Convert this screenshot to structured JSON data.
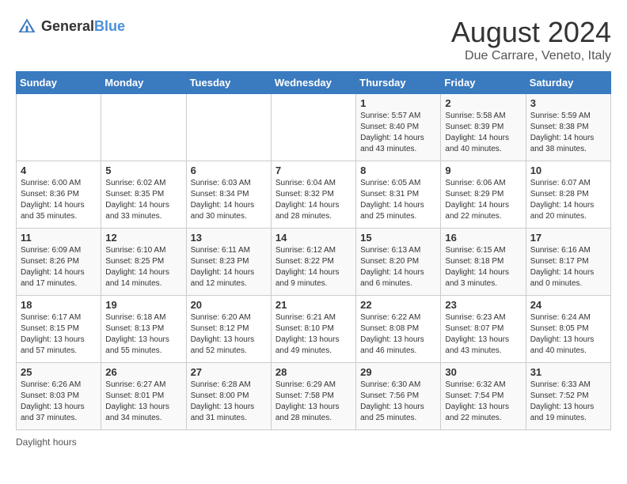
{
  "header": {
    "logo_line1": "General",
    "logo_line2": "Blue",
    "title": "August 2024",
    "subtitle": "Due Carrare, Veneto, Italy"
  },
  "calendar": {
    "days_of_week": [
      "Sunday",
      "Monday",
      "Tuesday",
      "Wednesday",
      "Thursday",
      "Friday",
      "Saturday"
    ],
    "weeks": [
      [
        {
          "day": "",
          "info": ""
        },
        {
          "day": "",
          "info": ""
        },
        {
          "day": "",
          "info": ""
        },
        {
          "day": "",
          "info": ""
        },
        {
          "day": "1",
          "info": "Sunrise: 5:57 AM\nSunset: 8:40 PM\nDaylight: 14 hours and 43 minutes."
        },
        {
          "day": "2",
          "info": "Sunrise: 5:58 AM\nSunset: 8:39 PM\nDaylight: 14 hours and 40 minutes."
        },
        {
          "day": "3",
          "info": "Sunrise: 5:59 AM\nSunset: 8:38 PM\nDaylight: 14 hours and 38 minutes."
        }
      ],
      [
        {
          "day": "4",
          "info": "Sunrise: 6:00 AM\nSunset: 8:36 PM\nDaylight: 14 hours and 35 minutes."
        },
        {
          "day": "5",
          "info": "Sunrise: 6:02 AM\nSunset: 8:35 PM\nDaylight: 14 hours and 33 minutes."
        },
        {
          "day": "6",
          "info": "Sunrise: 6:03 AM\nSunset: 8:34 PM\nDaylight: 14 hours and 30 minutes."
        },
        {
          "day": "7",
          "info": "Sunrise: 6:04 AM\nSunset: 8:32 PM\nDaylight: 14 hours and 28 minutes."
        },
        {
          "day": "8",
          "info": "Sunrise: 6:05 AM\nSunset: 8:31 PM\nDaylight: 14 hours and 25 minutes."
        },
        {
          "day": "9",
          "info": "Sunrise: 6:06 AM\nSunset: 8:29 PM\nDaylight: 14 hours and 22 minutes."
        },
        {
          "day": "10",
          "info": "Sunrise: 6:07 AM\nSunset: 8:28 PM\nDaylight: 14 hours and 20 minutes."
        }
      ],
      [
        {
          "day": "11",
          "info": "Sunrise: 6:09 AM\nSunset: 8:26 PM\nDaylight: 14 hours and 17 minutes."
        },
        {
          "day": "12",
          "info": "Sunrise: 6:10 AM\nSunset: 8:25 PM\nDaylight: 14 hours and 14 minutes."
        },
        {
          "day": "13",
          "info": "Sunrise: 6:11 AM\nSunset: 8:23 PM\nDaylight: 14 hours and 12 minutes."
        },
        {
          "day": "14",
          "info": "Sunrise: 6:12 AM\nSunset: 8:22 PM\nDaylight: 14 hours and 9 minutes."
        },
        {
          "day": "15",
          "info": "Sunrise: 6:13 AM\nSunset: 8:20 PM\nDaylight: 14 hours and 6 minutes."
        },
        {
          "day": "16",
          "info": "Sunrise: 6:15 AM\nSunset: 8:18 PM\nDaylight: 14 hours and 3 minutes."
        },
        {
          "day": "17",
          "info": "Sunrise: 6:16 AM\nSunset: 8:17 PM\nDaylight: 14 hours and 0 minutes."
        }
      ],
      [
        {
          "day": "18",
          "info": "Sunrise: 6:17 AM\nSunset: 8:15 PM\nDaylight: 13 hours and 57 minutes."
        },
        {
          "day": "19",
          "info": "Sunrise: 6:18 AM\nSunset: 8:13 PM\nDaylight: 13 hours and 55 minutes."
        },
        {
          "day": "20",
          "info": "Sunrise: 6:20 AM\nSunset: 8:12 PM\nDaylight: 13 hours and 52 minutes."
        },
        {
          "day": "21",
          "info": "Sunrise: 6:21 AM\nSunset: 8:10 PM\nDaylight: 13 hours and 49 minutes."
        },
        {
          "day": "22",
          "info": "Sunrise: 6:22 AM\nSunset: 8:08 PM\nDaylight: 13 hours and 46 minutes."
        },
        {
          "day": "23",
          "info": "Sunrise: 6:23 AM\nSunset: 8:07 PM\nDaylight: 13 hours and 43 minutes."
        },
        {
          "day": "24",
          "info": "Sunrise: 6:24 AM\nSunset: 8:05 PM\nDaylight: 13 hours and 40 minutes."
        }
      ],
      [
        {
          "day": "25",
          "info": "Sunrise: 6:26 AM\nSunset: 8:03 PM\nDaylight: 13 hours and 37 minutes."
        },
        {
          "day": "26",
          "info": "Sunrise: 6:27 AM\nSunset: 8:01 PM\nDaylight: 13 hours and 34 minutes."
        },
        {
          "day": "27",
          "info": "Sunrise: 6:28 AM\nSunset: 8:00 PM\nDaylight: 13 hours and 31 minutes."
        },
        {
          "day": "28",
          "info": "Sunrise: 6:29 AM\nSunset: 7:58 PM\nDaylight: 13 hours and 28 minutes."
        },
        {
          "day": "29",
          "info": "Sunrise: 6:30 AM\nSunset: 7:56 PM\nDaylight: 13 hours and 25 minutes."
        },
        {
          "day": "30",
          "info": "Sunrise: 6:32 AM\nSunset: 7:54 PM\nDaylight: 13 hours and 22 minutes."
        },
        {
          "day": "31",
          "info": "Sunrise: 6:33 AM\nSunset: 7:52 PM\nDaylight: 13 hours and 19 minutes."
        }
      ]
    ]
  },
  "footer": {
    "label": "Daylight hours"
  }
}
